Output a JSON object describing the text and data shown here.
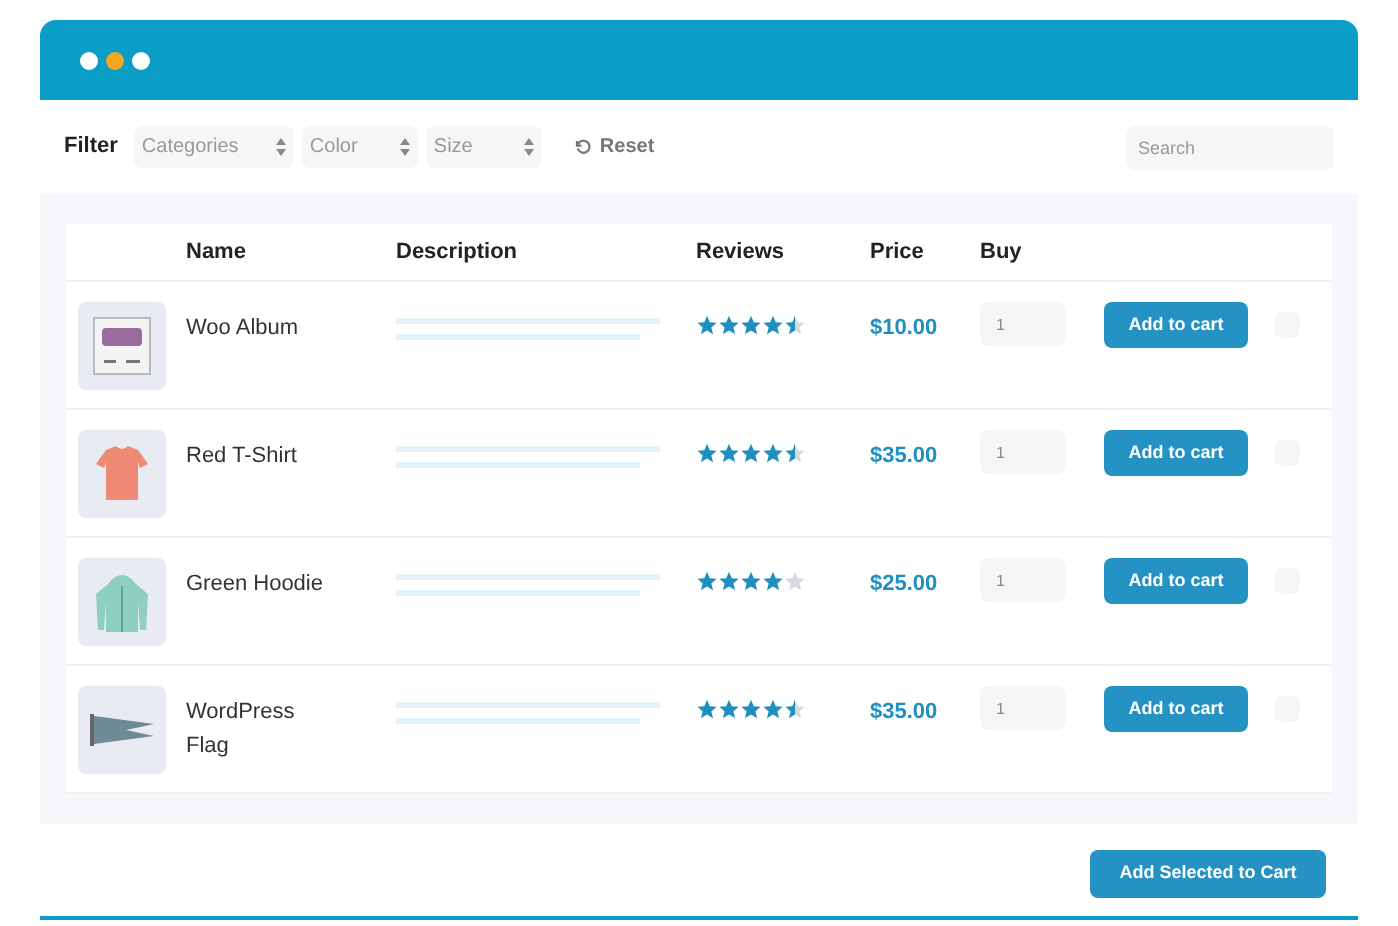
{
  "filter": {
    "label": "Filter",
    "selects": [
      {
        "placeholder": "Categories"
      },
      {
        "placeholder": "Color"
      },
      {
        "placeholder": "Size"
      }
    ],
    "reset": "Reset",
    "search": {
      "placeholder": "Search"
    }
  },
  "table": {
    "columns": [
      "Name",
      "Description",
      "Reviews",
      "Price",
      "Buy"
    ],
    "rows": [
      {
        "name": "Woo Album",
        "stars": 4.5,
        "price": "$10.00",
        "qty": "1",
        "button": "Add to cart",
        "checked": false,
        "kind": "album"
      },
      {
        "name": "Red T-Shirt",
        "stars": 4.5,
        "price": "$35.00",
        "qty": "1",
        "button": "Add to cart",
        "checked": false,
        "kind": "shirt"
      },
      {
        "name": "Green Hoodie",
        "stars": 4,
        "price": "$25.00",
        "qty": "1",
        "button": "Add to cart",
        "checked": false,
        "kind": "hoodie"
      },
      {
        "name": "WordPress Flag",
        "stars": 4.5,
        "price": "$35.00",
        "qty": "1",
        "button": "Add to cart",
        "checked": false,
        "kind": "flag"
      }
    ]
  },
  "footer": {
    "button": "Add Selected to Cart"
  }
}
